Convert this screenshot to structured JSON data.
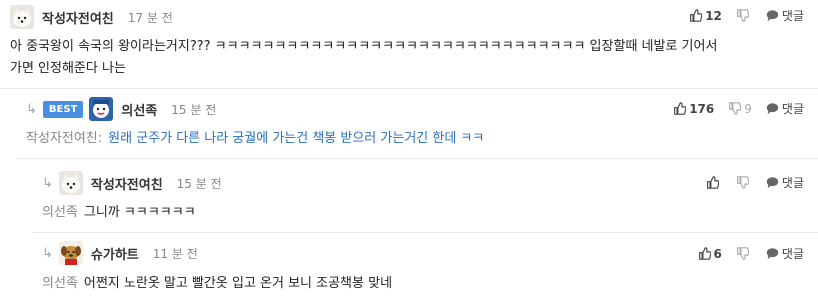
{
  "comments": [
    {
      "author": "작성자전여친",
      "time": "17 분 전",
      "likes": "12",
      "dislikes": "",
      "reply_label": "댓글",
      "body_lines": [
        "아 중국왕이 속국의 왕이라는거지??? ㅋㅋㅋㅋㅋㅋㅋㅋㅋㅋㅋㅋㅋㅋㅋㅋㅋㅋㅋㅋㅋㅋㅋㅋㅋㅋㅋㅋㅋㅋㅋ 입장할때 네발로 기어서",
        "가면 인정해준다 나는"
      ]
    },
    {
      "badge": "BEST",
      "author": "의선족",
      "time": "15 분 전",
      "likes": "176",
      "dislikes": "9",
      "reply_label": "댓글",
      "mention": "작성자전여친:",
      "body": "원래 군주가 다른 나라 궁궐에 가는건 책봉 받으러 가는거긴 한데 ㅋㅋ"
    },
    {
      "author": "작성자전여친",
      "time": "15 분 전",
      "likes": "",
      "dislikes": "",
      "reply_label": "댓글",
      "mention": "의선족",
      "body": "그니까 ㅋㅋㅋㅋㅋㅋ"
    },
    {
      "author": "슈가하트",
      "time": "11 분 전",
      "likes": "6",
      "dislikes": "",
      "reply_label": "댓글",
      "mention": "의선족",
      "body": "어쩐지 노란옷 말고 빨간옷 입고 온거 보니 조공책봉 맞네"
    }
  ]
}
